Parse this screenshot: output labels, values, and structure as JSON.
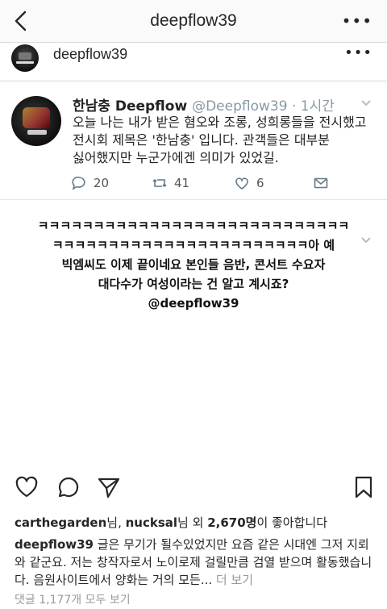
{
  "header": {
    "title": "deepflow39"
  },
  "post": {
    "username": "deepflow39",
    "tweet": {
      "name": "한남충 Deepflow",
      "handle": "@Deepflow39 · 1시간",
      "text_lines": [
        "오늘 나는 내가 받은 혐오와 조롱, 성희롱들을 전시했고",
        "전시회 제목은 '한남충' 입니다. 관객들은 대부분",
        "싫어했지만 누군가에겐 의미가 있었길."
      ],
      "replies": "20",
      "retweets": "41",
      "likes": "6"
    },
    "image_caption_lines": [
      "ㅋㅋㅋㅋㅋㅋㅋㅋㅋㅋㅋㅋㅋㅋㅋㅋㅋㅋㅋㅋㅋㅋㅋㅋㅋㅋㅋㅋ",
      "ㅋㅋㅋㅋㅋㅋㅋㅋㅋㅋㅋㅋㅋㅋㅋㅋㅋㅋㅋㅋㅋㅋㅋ아 예",
      "빅엠씨도 이제 끝이네요 본인들 음반, 콘서트 수요자",
      "대다수가 여성이라는 건 알고 계시죠?",
      "@deepflow39"
    ],
    "likes_line": {
      "user1": "carthegarden",
      "sep1": "님, ",
      "user2": "nucksal",
      "sep2": "님 외 ",
      "count": "2,670명",
      "suffix": "이 좋아합니다"
    },
    "caption_user": "deepflow39",
    "caption_text": " 글은 무기가 될수있었지만 요즘 같은 시대엔 그저 지뢰와 같군요. 저는 창작자로서 노이로제 걸릴만큼 검열 받으며 활동했습니다. 음원사이트에서 양화는 거의 모든...",
    "more_label": " 더 보기",
    "view_comments": "댓글 1,177개 모두 보기"
  }
}
